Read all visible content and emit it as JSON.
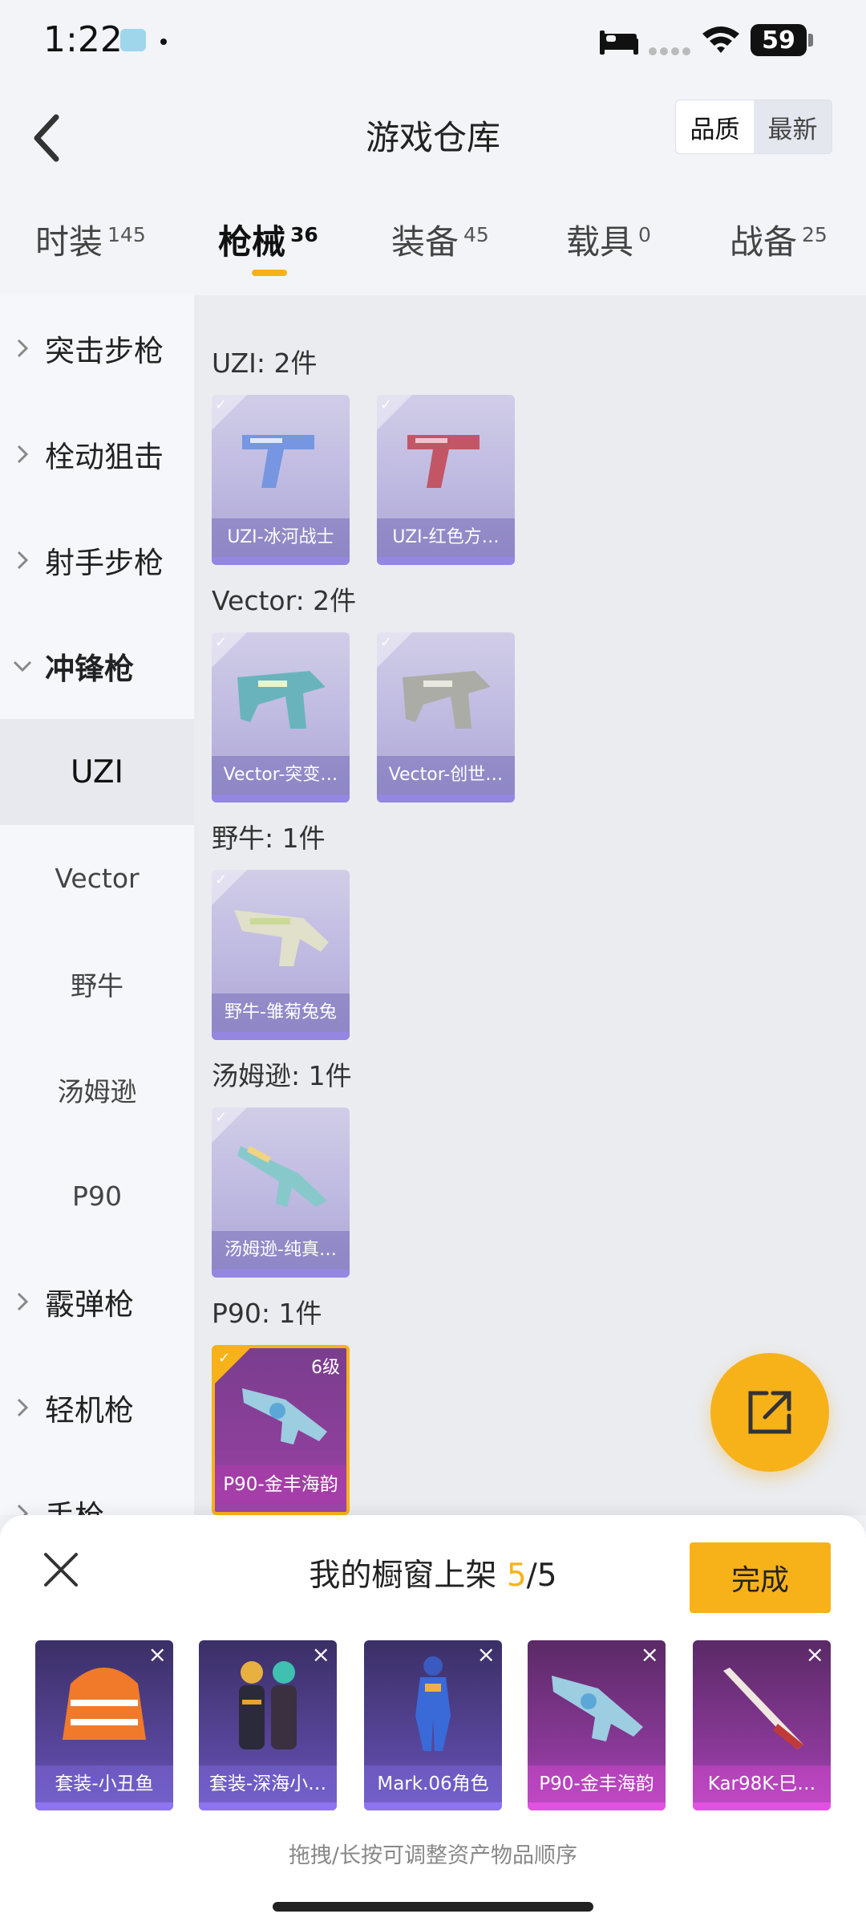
{
  "status": {
    "time": "1:22",
    "battery": "59"
  },
  "header": {
    "title": "游戏仓库",
    "sort_options": [
      "品质",
      "最新"
    ],
    "sort_active": "品质"
  },
  "tabs": [
    {
      "label": "时装",
      "count": "145"
    },
    {
      "label": "枪械",
      "count": "36"
    },
    {
      "label": "装备",
      "count": "45"
    },
    {
      "label": "载具",
      "count": "0"
    },
    {
      "label": "战备",
      "count": "25"
    }
  ],
  "active_tab": "枪械",
  "sidebar": {
    "items": [
      {
        "label": "突击步枪"
      },
      {
        "label": "栓动狙击"
      },
      {
        "label": "射手步枪"
      },
      {
        "label": "冲锋枪"
      },
      {
        "label": "UZI"
      },
      {
        "label": "Vector"
      },
      {
        "label": "野牛"
      },
      {
        "label": "汤姆逊"
      },
      {
        "label": "P90"
      },
      {
        "label": "霰弹枪"
      },
      {
        "label": "轻机枪"
      },
      {
        "label": "手枪"
      }
    ],
    "active": "UZI"
  },
  "groups": [
    {
      "title": "UZI: 2件",
      "items": [
        {
          "name": "UZI-冰河战士"
        },
        {
          "name": "UZI-红色方…"
        }
      ]
    },
    {
      "title": "Vector: 2件",
      "items": [
        {
          "name": "Vector-突变…"
        },
        {
          "name": "Vector-创世…"
        }
      ]
    },
    {
      "title": "野牛: 1件",
      "items": [
        {
          "name": "野牛-雏菊兔兔"
        }
      ]
    },
    {
      "title": "汤姆逊: 1件",
      "items": [
        {
          "name": "汤姆逊-纯真…"
        }
      ]
    },
    {
      "title": "P90: 1件",
      "items": [
        {
          "name": "P90-金丰海韵",
          "level": "6级",
          "selected": true
        }
      ]
    }
  ],
  "showcase": {
    "title_prefix": "我的橱窗上架",
    "current": "5",
    "total": "/5",
    "done_label": "完成",
    "items": [
      {
        "name": "套装-小丑鱼"
      },
      {
        "name": "套装-深海小…"
      },
      {
        "name": "Mark.06角色"
      },
      {
        "name": "P90-金丰海韵"
      },
      {
        "name": "Kar98K-巳…"
      }
    ],
    "hint": "拖拽/长按可调整资产物品顺序"
  },
  "colors": {
    "accent": "#f7b21a",
    "card_purple": "#b8b2de",
    "selected_pink": "#b44fc0"
  }
}
